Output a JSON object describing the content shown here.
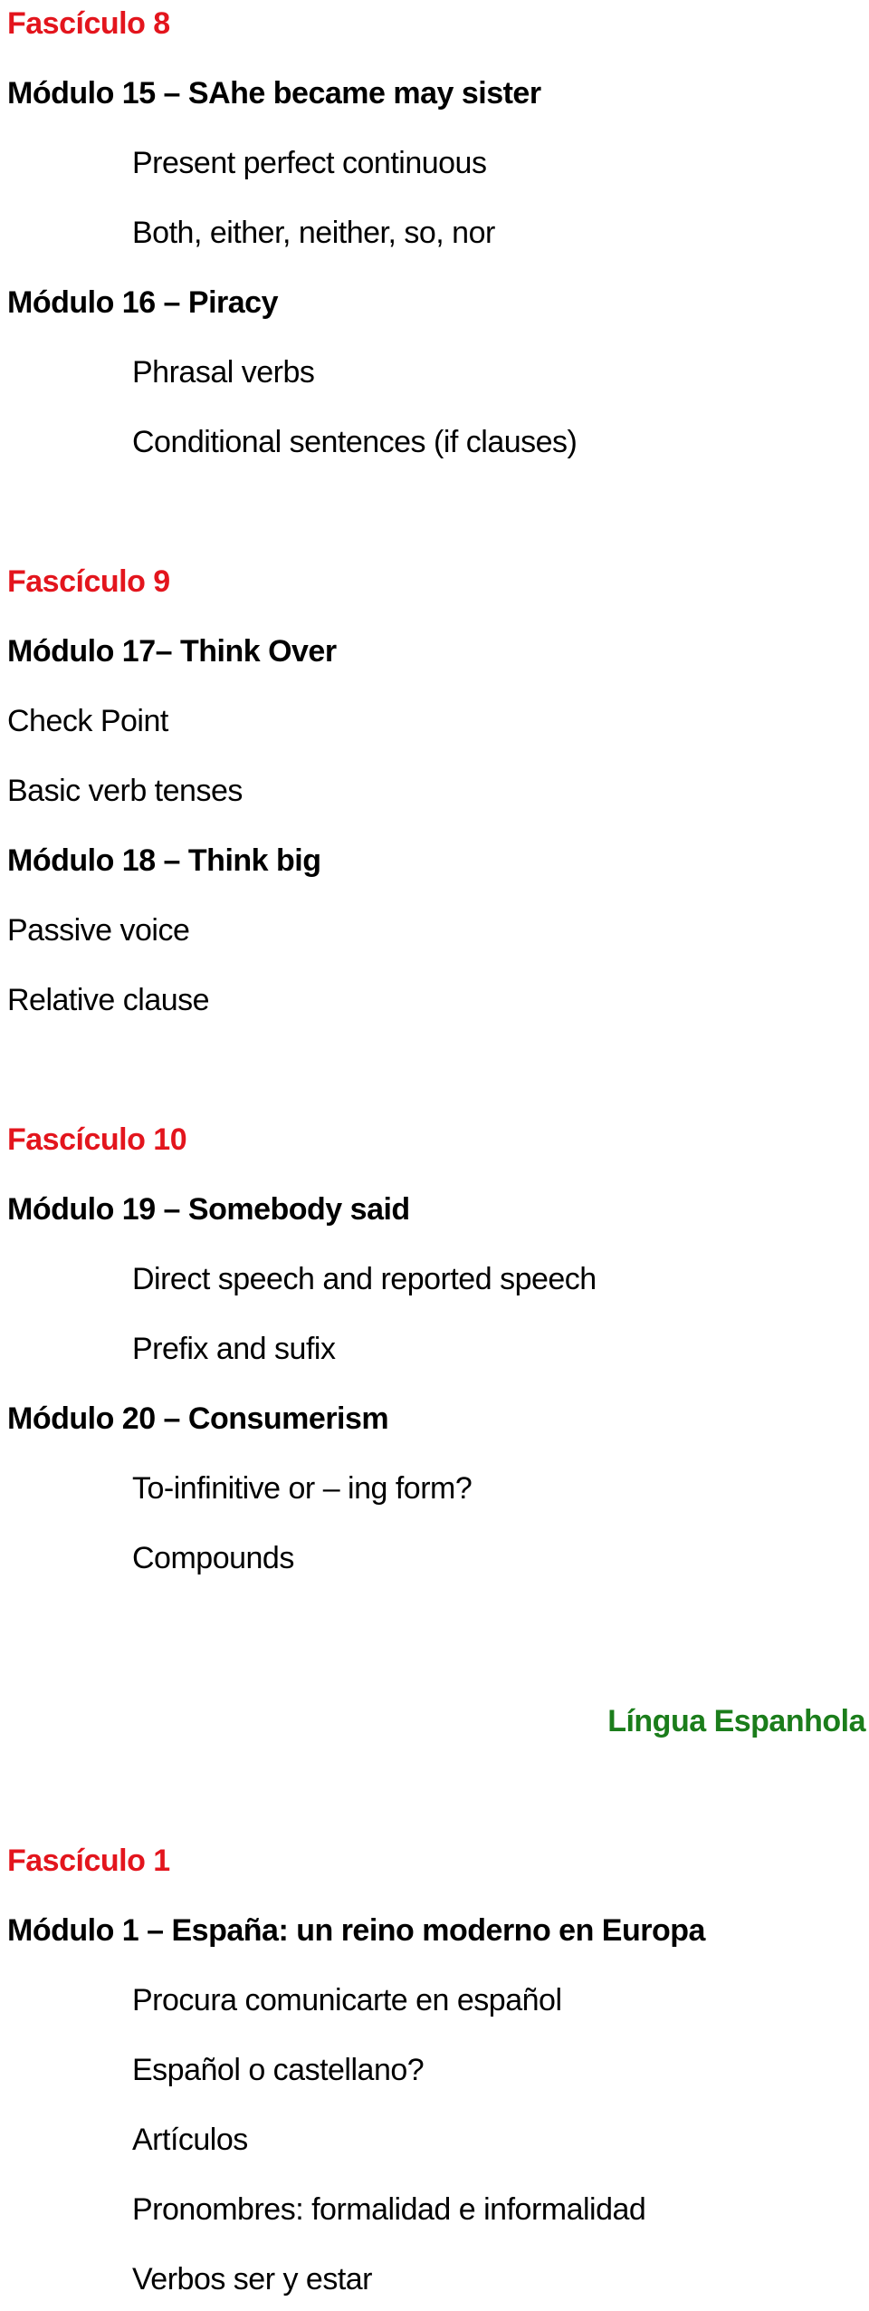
{
  "colors": {
    "fasciculo": "#e3151d",
    "module": "#000000",
    "topic": "#000000",
    "subject": "#1b7d1b"
  },
  "sections": [
    {
      "fasciculo": "Fascículo 8",
      "modules": [
        {
          "title": "Módulo 15 – SAhe became may sister",
          "topics": [
            "Present perfect continuous",
            "Both, either, neither, so, nor"
          ]
        },
        {
          "title": "Módulo 16 – Piracy",
          "topics": [
            "Phrasal verbs",
            "Conditional sentences (if clauses)"
          ]
        }
      ]
    },
    {
      "fasciculo": "Fascículo 9",
      "modules": [
        {
          "title": "Módulo 17– Think Over",
          "topics": [
            "Check Point",
            "Basic verb tenses"
          ]
        },
        {
          "title": "Módulo 18 – Think big",
          "topics": [
            "Passive voice",
            "Relative clause"
          ]
        }
      ]
    },
    {
      "fasciculo": "Fascículo 10",
      "modules": [
        {
          "title": "Módulo 19 – Somebody said",
          "topics": [
            "Direct speech and reported speech",
            "Prefix and sufix"
          ]
        },
        {
          "title": "Módulo 20 – Consumerism",
          "topics": [
            "To-infinitive or – ing form?",
            "Compounds"
          ]
        }
      ]
    }
  ],
  "subject_heading": "Língua Espanhola",
  "spanish_sections": [
    {
      "fasciculo": "Fascículo 1",
      "modules": [
        {
          "title": "Módulo 1 – España: un reino moderno en Europa",
          "topics": [
            "Procura comunicarte en español",
            "Español o castellano?",
            "Artículos",
            "Pronombres: formalidad e informalidad",
            "Verbos ser y estar"
          ]
        }
      ]
    }
  ]
}
